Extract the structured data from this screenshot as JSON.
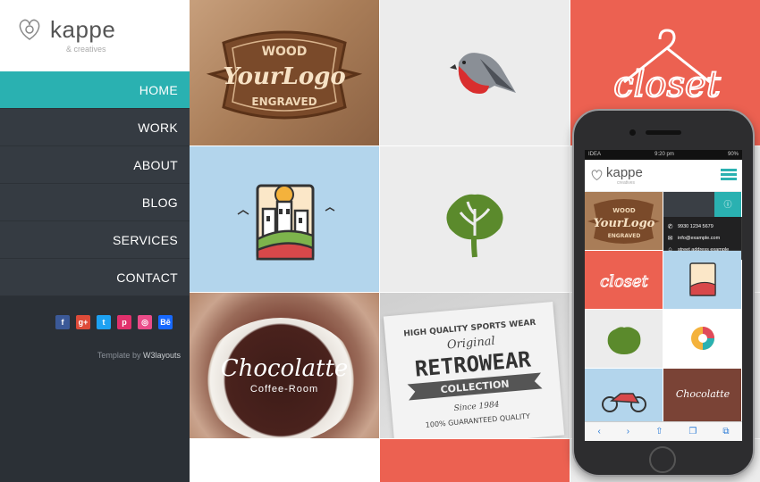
{
  "brand": {
    "name": "kappe",
    "tagline": "creatives"
  },
  "nav": {
    "items": [
      {
        "label": "HOME",
        "active": true
      },
      {
        "label": "WORK",
        "active": false
      },
      {
        "label": "ABOUT",
        "active": false
      },
      {
        "label": "BLOG",
        "active": false
      },
      {
        "label": "SERVICES",
        "active": false
      },
      {
        "label": "CONTACT",
        "active": false
      }
    ]
  },
  "social": [
    {
      "icon": "facebook-icon",
      "glyph": "f",
      "color": "#3b5998"
    },
    {
      "icon": "google-plus-icon",
      "glyph": "g+",
      "color": "#dd4b39"
    },
    {
      "icon": "twitter-icon",
      "glyph": "t",
      "color": "#1da1f2"
    },
    {
      "icon": "pinterest-icon",
      "glyph": "p",
      "color": "#e1306c"
    },
    {
      "icon": "dribbble-icon",
      "glyph": "◎",
      "color": "#ea4c89"
    },
    {
      "icon": "behance-icon",
      "glyph": "Bē",
      "color": "#1769ff"
    }
  ],
  "credit": {
    "prefix": "Template by",
    "author": "W3layouts"
  },
  "tiles": {
    "wood": {
      "top": "WOOD",
      "main": "YourLogo",
      "bottom": "ENGRAVED"
    },
    "closet": {
      "text": "closet"
    },
    "chocolate": {
      "title": "Chocolatte",
      "subtitle": "Coffee-Room"
    },
    "retro": {
      "arc": "HIGH QUALITY SPORTS WEAR",
      "original": "Original",
      "main": "RETROWEAR",
      "ribbon": "COLLECTION",
      "since": "Since 1984",
      "guarantee": "100% GUARANTEED QUALITY"
    }
  },
  "phone": {
    "status": {
      "carrier": "IDEA",
      "time": "9:20 pm",
      "battery": "90%"
    },
    "brand": {
      "name": "kappe",
      "tagline": "creatives"
    },
    "info": {
      "phone": "9930 1234 5679",
      "email": "info@example.com",
      "address": "street address example"
    }
  },
  "colors": {
    "accent": "#2ab1b1",
    "sidebar": "#2b3036",
    "coral": "#ec6151"
  }
}
